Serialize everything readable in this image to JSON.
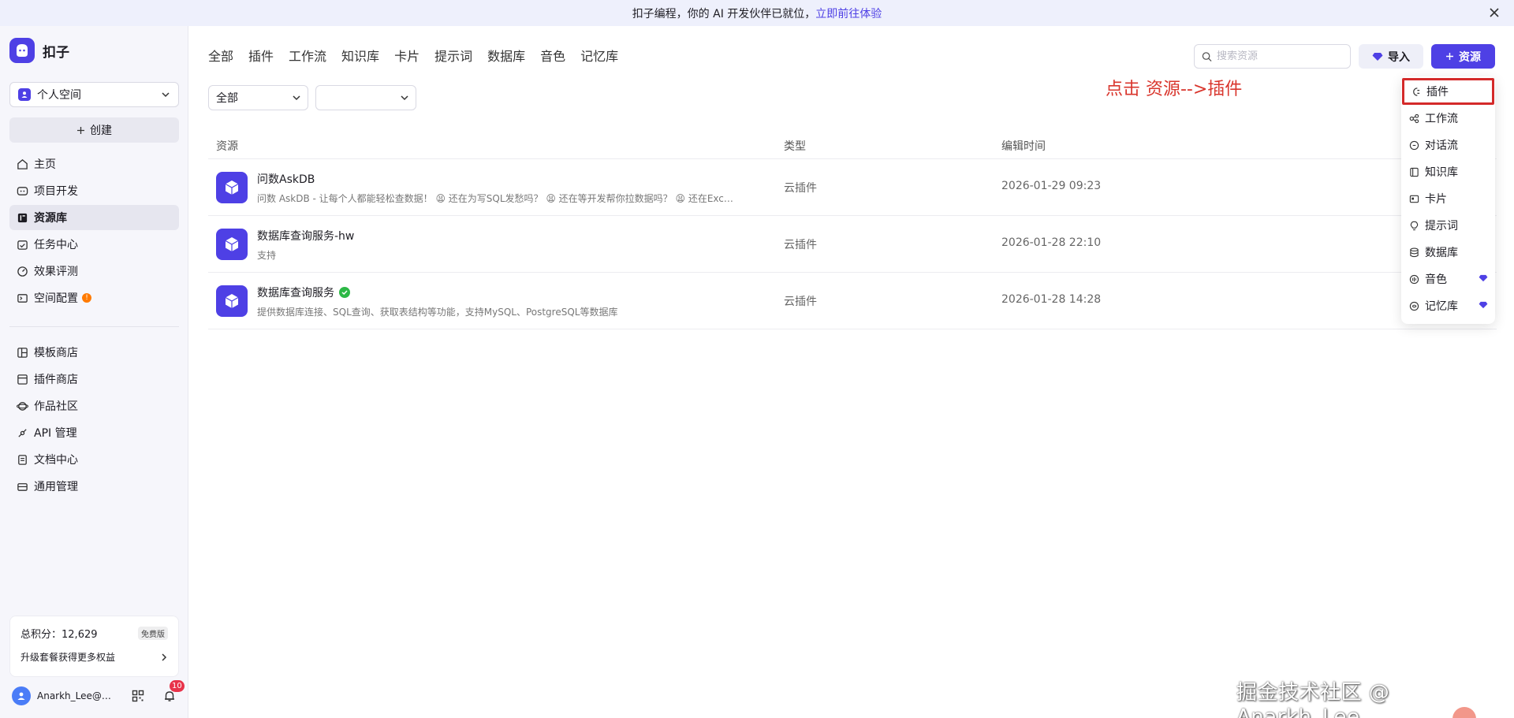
{
  "banner": {
    "text": "扣子编程，你的 AI 开发伙伴已就位，",
    "link": "立即前往体验"
  },
  "brand": {
    "name": "扣子"
  },
  "sidebar": {
    "space": "个人空间",
    "create_label": "创建",
    "nav_main": [
      {
        "label": "主页",
        "icon": "home-icon"
      },
      {
        "label": "项目开发",
        "icon": "project-icon"
      },
      {
        "label": "资源库",
        "icon": "library-icon",
        "active": true
      },
      {
        "label": "任务中心",
        "icon": "task-icon"
      },
      {
        "label": "效果评测",
        "icon": "gauge-icon"
      },
      {
        "label": "空间配置",
        "icon": "config-icon",
        "badge": "!"
      }
    ],
    "nav_secondary": [
      {
        "label": "模板商店",
        "icon": "template-icon"
      },
      {
        "label": "插件商店",
        "icon": "plugin-store-icon"
      },
      {
        "label": "作品社区",
        "icon": "community-icon"
      },
      {
        "label": "API 管理",
        "icon": "api-icon"
      },
      {
        "label": "文档中心",
        "icon": "doc-icon"
      },
      {
        "label": "通用管理",
        "icon": "manage-icon"
      }
    ],
    "points_label": "总积分：",
    "points_value": "12,629",
    "plan_badge": "免费版",
    "upgrade_label": "升级套餐获得更多权益",
    "user_name": "Anarkh_Lee@…",
    "notification_count": "10"
  },
  "tabs": [
    "全部",
    "插件",
    "工作流",
    "知识库",
    "卡片",
    "提示词",
    "数据库",
    "音色",
    "记忆库"
  ],
  "filters": {
    "type": "全部",
    "second": ""
  },
  "search": {
    "placeholder": "搜索资源"
  },
  "buttons": {
    "import": "导入",
    "resource": "资源"
  },
  "annotation": "点击 资源-->插件",
  "table": {
    "columns": [
      "资源",
      "类型",
      "编辑时间"
    ],
    "rows": [
      {
        "name": "问数AskDB",
        "desc": "问数 AskDB - 让每个人都能轻松查数据！ 😫 还在为写SQL发愁吗？ 😫 还在等开发帮你拉数据吗？ 😫 还在Exce…",
        "type": "云插件",
        "time": "2026-01-29 09:23",
        "verified": false
      },
      {
        "name": "数据库查询服务-hw",
        "desc": "支持",
        "type": "云插件",
        "time": "2026-01-28 22:10",
        "verified": false
      },
      {
        "name": "数据库查询服务",
        "desc": "提供数据库连接、SQL查询、获取表结构等功能，支持MySQL、PostgreSQL等数据库",
        "type": "云插件",
        "time": "2026-01-28 14:28",
        "verified": true
      }
    ]
  },
  "dropdown": [
    {
      "label": "插件",
      "icon": "plugin-icon",
      "highlight": true
    },
    {
      "label": "工作流",
      "icon": "workflow-icon"
    },
    {
      "label": "对话流",
      "icon": "chatflow-icon"
    },
    {
      "label": "知识库",
      "icon": "knowledge-icon"
    },
    {
      "label": "卡片",
      "icon": "card-icon"
    },
    {
      "label": "提示词",
      "icon": "prompt-icon"
    },
    {
      "label": "数据库",
      "icon": "database-icon"
    },
    {
      "label": "音色",
      "icon": "voice-icon",
      "premium": true
    },
    {
      "label": "记忆库",
      "icon": "memory-icon",
      "premium": true
    }
  ],
  "watermark": "掘金技术社区 @ Anarkh_Lee",
  "colors": {
    "accent": "#4e40e5",
    "annotation": "#d9362d",
    "verified": "#2db846"
  }
}
